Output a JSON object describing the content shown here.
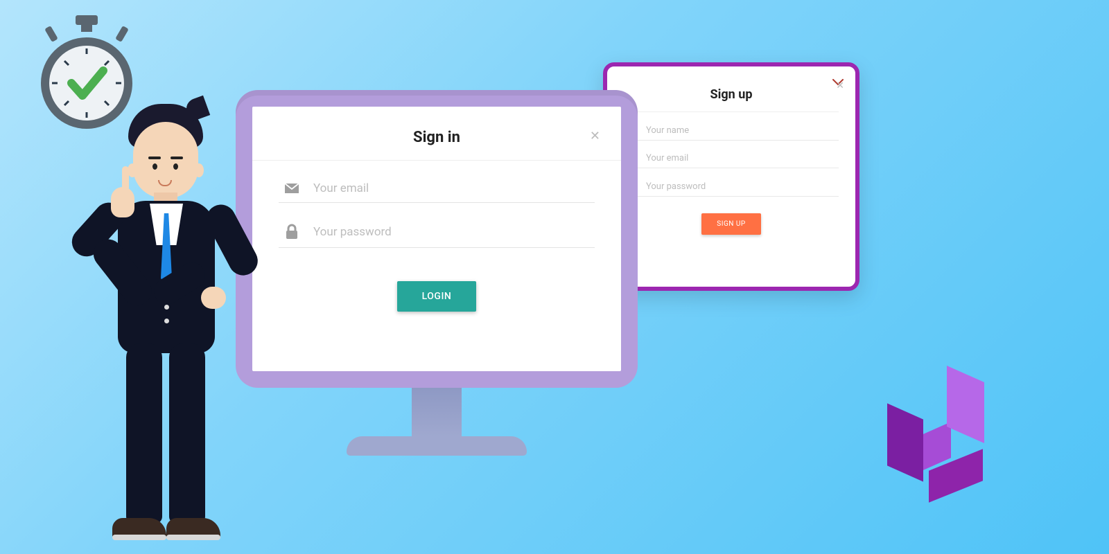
{
  "signin": {
    "title": "Sign in",
    "email_placeholder": "Your email",
    "password_placeholder": "Your password",
    "login_label": "LOGIN"
  },
  "signup": {
    "title": "Sign up",
    "name_placeholder": "Your name",
    "email_placeholder": "Your email",
    "password_placeholder": "Your password",
    "signup_label": "SIGN UP"
  },
  "icons": {
    "envelope": "envelope-icon",
    "lock": "lock-icon",
    "person": "person-icon",
    "close": "close-icon",
    "chevron_down": "chevron-down-icon",
    "stopwatch": "stopwatch-check-icon",
    "logo": "brand-logo"
  },
  "colors": {
    "signin_button": "#26a69a",
    "signup_button": "#ff7043",
    "signup_border": "#9c27b0",
    "monitor_bezel": "#b39ddb"
  }
}
